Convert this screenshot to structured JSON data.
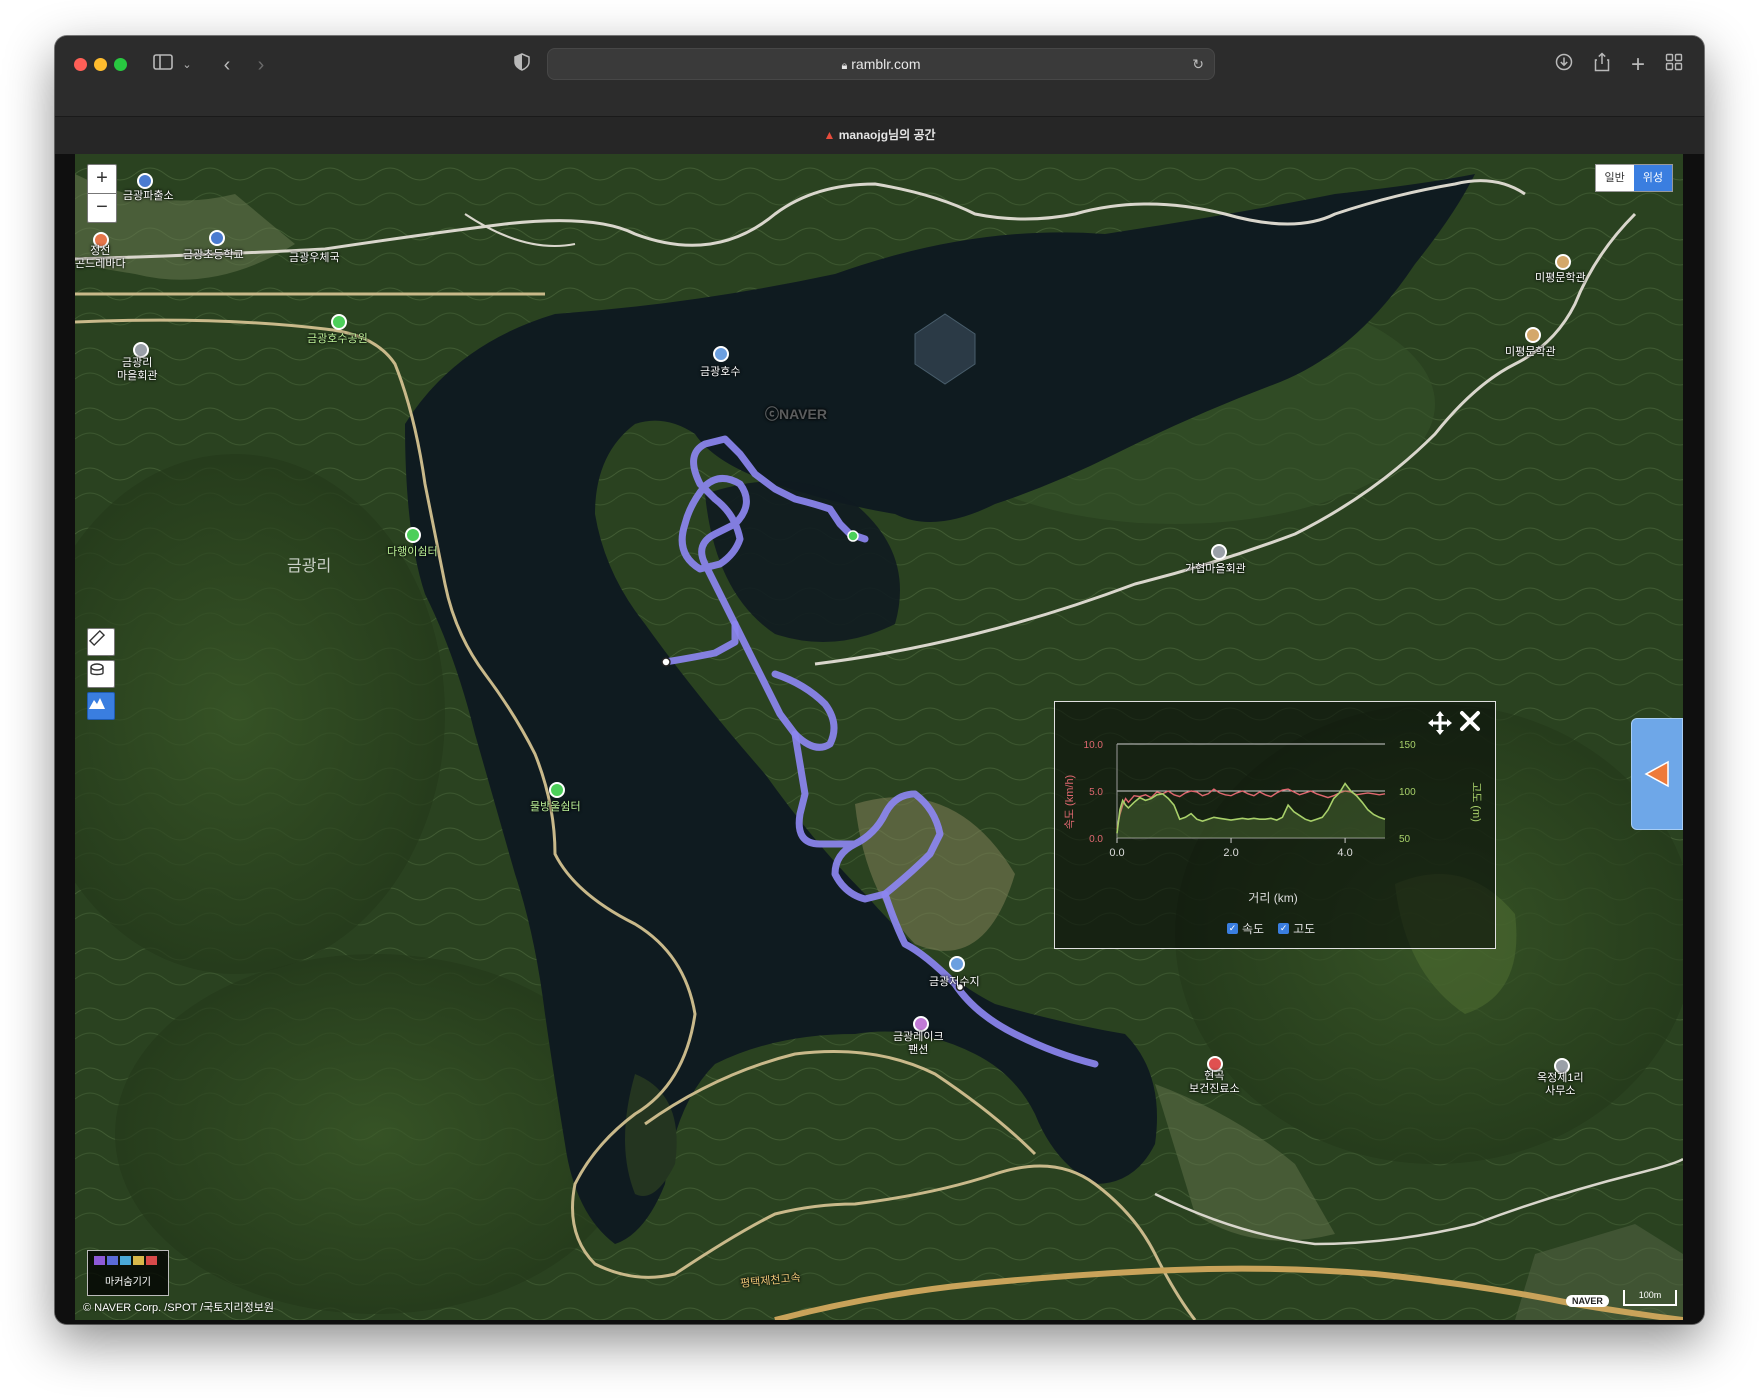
{
  "browser": {
    "url": "ramblr.com",
    "tab_title": "manaojg님의 공간"
  },
  "map": {
    "map_type_buttons": [
      "일반",
      "위성"
    ],
    "active_map_type": "위성",
    "zoom_in": "+",
    "zoom_out": "−",
    "watermark": "ⓒNAVER",
    "labels": [
      {
        "id": "geumgwang-police",
        "text": "금광파출소"
      },
      {
        "id": "jeongseon",
        "text": "정선\n곤드레바다"
      },
      {
        "id": "geumgwang-elementary",
        "text": "금광초등학교"
      },
      {
        "id": "geumgwang-post",
        "text": "금광우체국"
      },
      {
        "id": "geumgwang-lake-park",
        "text": "금광호수공원"
      },
      {
        "id": "geumgwangri-hall",
        "text": "금광리\n마을회관"
      },
      {
        "id": "geumgwang-lake",
        "text": "금광호수"
      },
      {
        "id": "mipyeong-1",
        "text": "미평문학관"
      },
      {
        "id": "mipyeong-2",
        "text": "미평문학관"
      },
      {
        "id": "dahaengi-shelter",
        "text": "다행이쉼터"
      },
      {
        "id": "geumgwangri",
        "text": "금광리"
      },
      {
        "id": "gapyeop-hall",
        "text": "가협마을회관"
      },
      {
        "id": "mulbangul-shelter",
        "text": "물방울쉼터"
      },
      {
        "id": "geumgwang-reservoir",
        "text": "금광저수지"
      },
      {
        "id": "geumgwang-lake-pension",
        "text": "금광레이크\n팬션"
      },
      {
        "id": "hyeongok-clinic",
        "text": "현곡\n보건진료소"
      },
      {
        "id": "okjeong-office",
        "text": "옥정제1리\n사무소"
      },
      {
        "id": "highway",
        "text": "평택제천고속"
      }
    ],
    "copyright": "© NAVER Corp. /SPOT /국토지리정보원",
    "naver_logo": "NAVER",
    "scale": "100m",
    "marker_legend_label": "마커숨기기"
  },
  "chart_data": {
    "type": "line",
    "xlabel": "거리 (km)",
    "y_left_label": "속도 (km/h)",
    "y_right_label": "고도 (m)",
    "x_ticks": [
      "0.0",
      "2.0",
      "4.0"
    ],
    "y_left_ticks": [
      "0.0",
      "5.0",
      "10.0"
    ],
    "y_right_ticks": [
      "50",
      "100",
      "150"
    ],
    "xlim": [
      0,
      4.7
    ],
    "y_left_lim": [
      0,
      10
    ],
    "y_right_lim": [
      50,
      150
    ],
    "grid": true,
    "legend_position": "bottom",
    "series": [
      {
        "name": "속도",
        "axis": "left",
        "color": "#e06870",
        "x": [
          0.0,
          0.05,
          0.1,
          0.15,
          0.2,
          0.3,
          0.4,
          0.5,
          0.6,
          0.7,
          0.8,
          0.9,
          1.0,
          1.1,
          1.2,
          1.3,
          1.4,
          1.5,
          1.6,
          1.7,
          1.8,
          1.9,
          2.0,
          2.1,
          2.2,
          2.3,
          2.4,
          2.5,
          2.6,
          2.7,
          2.8,
          2.9,
          3.0,
          3.1,
          3.2,
          3.3,
          3.4,
          3.5,
          3.6,
          3.7,
          3.8,
          3.9,
          4.0,
          4.1,
          4.2,
          4.3,
          4.4,
          4.5,
          4.6,
          4.7
        ],
        "values": [
          1.0,
          2.5,
          3.5,
          4.2,
          3.8,
          4.5,
          4.4,
          4.6,
          4.3,
          4.9,
          4.7,
          5.0,
          4.6,
          4.4,
          4.8,
          5.0,
          4.9,
          4.5,
          4.7,
          5.2,
          4.8,
          4.6,
          4.5,
          4.8,
          5.0,
          4.7,
          4.5,
          4.9,
          4.6,
          4.4,
          4.8,
          5.1,
          5.2,
          4.9,
          4.6,
          4.8,
          5.0,
          4.7,
          4.5,
          4.3,
          4.5,
          4.8,
          5.0,
          4.9,
          4.6,
          4.7,
          4.8,
          4.7,
          4.6,
          4.7
        ]
      },
      {
        "name": "고도",
        "axis": "right",
        "color": "#a8d06a",
        "x": [
          0.0,
          0.05,
          0.1,
          0.15,
          0.2,
          0.3,
          0.4,
          0.5,
          0.6,
          0.7,
          0.8,
          0.9,
          1.0,
          1.1,
          1.2,
          1.3,
          1.4,
          1.5,
          1.6,
          1.7,
          1.8,
          1.9,
          2.0,
          2.1,
          2.2,
          2.3,
          2.4,
          2.5,
          2.6,
          2.7,
          2.8,
          2.9,
          3.0,
          3.1,
          3.2,
          3.3,
          3.4,
          3.5,
          3.6,
          3.7,
          3.8,
          3.9,
          4.0,
          4.1,
          4.2,
          4.3,
          4.4,
          4.5,
          4.6,
          4.7
        ],
        "values": [
          55,
          80,
          90,
          85,
          82,
          88,
          93,
          90,
          92,
          96,
          97,
          92,
          85,
          70,
          72,
          76,
          70,
          68,
          70,
          72,
          71,
          70,
          69,
          70,
          71,
          70,
          71,
          70,
          70,
          71,
          69,
          72,
          85,
          78,
          74,
          70,
          68,
          70,
          72,
          80,
          92,
          98,
          108,
          100,
          95,
          88,
          80,
          75,
          72,
          70
        ]
      }
    ]
  },
  "chart_legend": [
    {
      "label": "속도",
      "checked": true
    },
    {
      "label": "고도",
      "checked": true
    }
  ],
  "colors": {
    "track": "#8c86f0",
    "accent_blue": "#3a7ee0",
    "side_tab": "#6ea7e8",
    "side_arrow": "#ee7a3a"
  }
}
